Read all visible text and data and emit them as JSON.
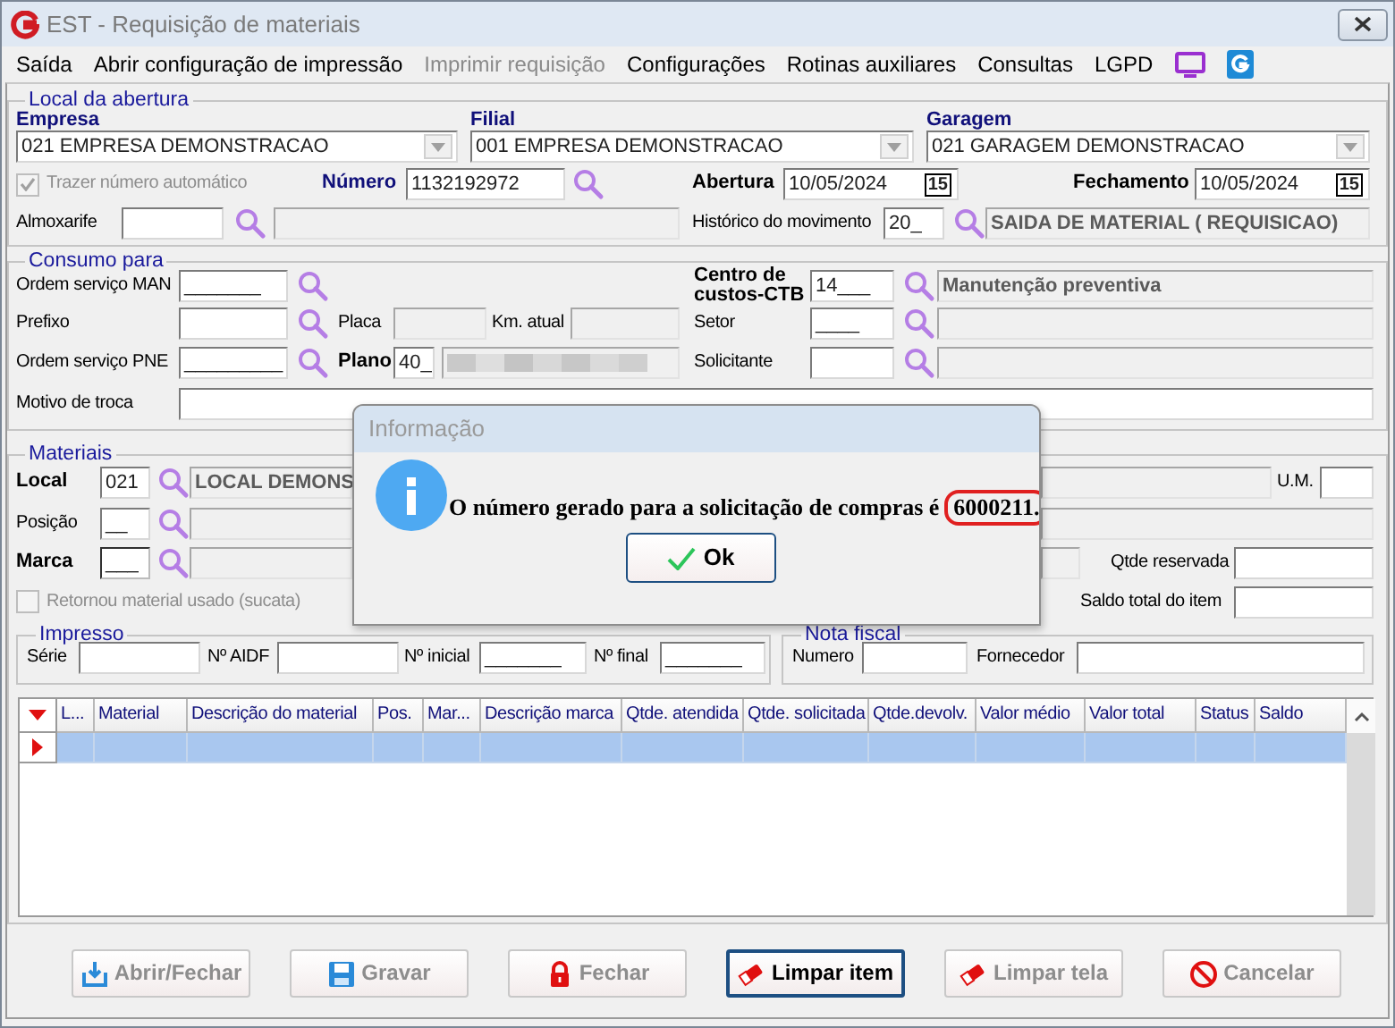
{
  "window": {
    "title": "EST - Requisição de materiais"
  },
  "menu": [
    {
      "label": "Saída",
      "disabled": false
    },
    {
      "label": "Abrir configuração de impressão",
      "disabled": false
    },
    {
      "label": "Imprimir requisição",
      "disabled": true
    },
    {
      "label": "Configurações",
      "disabled": false
    },
    {
      "label": "Rotinas auxiliares",
      "disabled": false
    },
    {
      "label": "Consultas",
      "disabled": false
    },
    {
      "label": "LGPD",
      "disabled": false
    }
  ],
  "menu_icons": [
    {
      "kind": "monitor"
    },
    {
      "kind": "logo"
    }
  ],
  "local_abertura": {
    "title": "Local da abertura",
    "combos": [
      {
        "label": "Empresa",
        "value": "021 EMPRESA DEMONSTRACAO"
      },
      {
        "label": "Filial",
        "value": "001 EMPRESA DEMONSTRACAO"
      },
      {
        "label": "Garagem",
        "value": "021 GARAGEM DEMONSTRACAO"
      }
    ],
    "auto_number": {
      "label": "Trazer número automático",
      "checked": true,
      "disabled": true
    },
    "numero": {
      "label": "Número",
      "value": "1132192972"
    },
    "abertura": {
      "label": "Abertura",
      "value": "10/05/2024",
      "calendar": "15"
    },
    "fechamento": {
      "label": "Fechamento",
      "value": "10/05/2024",
      "calendar": "15"
    },
    "almoxarife": {
      "label": "Almoxarife"
    },
    "historico": {
      "label": "Histórico do movimento",
      "value": "20_",
      "description": "SAIDA DE MATERIAL ( REQUISICAO)"
    }
  },
  "consumo": {
    "title": "Consumo para",
    "ordem_man": {
      "label": "Ordem serviço MAN",
      "value": "_______"
    },
    "centro_custos": {
      "label": "Centro de custos-CTB",
      "value": "14___",
      "description": "Manutenção preventiva"
    },
    "prefixo": {
      "label": "Prefixo"
    },
    "placa": {
      "label": "Placa"
    },
    "km_atual": {
      "label": "Km. atual"
    },
    "setor": {
      "label": "Setor",
      "value": "____"
    },
    "ordem_pne": {
      "label": "Ordem serviço PNE",
      "value": "_________"
    },
    "plano": {
      "label": "Plano",
      "value": "40_",
      "blurred": true
    },
    "solicitante": {
      "label": "Solicitante"
    },
    "motivo": {
      "label": "Motivo de troca"
    }
  },
  "materiais": {
    "title": "Materiais",
    "local": {
      "label": "Local",
      "value": "021",
      "description": "LOCAL DEMONS"
    },
    "um": {
      "label": "U.M."
    },
    "posicao": {
      "label": "Posição",
      "value": "__"
    },
    "marca": {
      "label": "Marca",
      "value": "___"
    },
    "qtde_reservada": {
      "label": "Qtde reservada"
    },
    "retornou": {
      "label": "Retornou material usado (sucata)",
      "checked": false,
      "disabled": true
    },
    "saldo_total": {
      "label": "Saldo total do item"
    },
    "impresso": {
      "title": "Impresso",
      "fields": [
        {
          "label": "Série"
        },
        {
          "label": "Nº AIDF"
        },
        {
          "label": "Nº inicial",
          "value": "_______"
        },
        {
          "label": "Nº final",
          "value": "_______"
        }
      ]
    },
    "nota_fiscal": {
      "title": "Nota fiscal",
      "fields": [
        {
          "label": "Numero"
        },
        {
          "label": "Fornecedor"
        }
      ]
    },
    "grid": {
      "columns": [
        "L...",
        "Material",
        "Descrição do material",
        "Pos.",
        "Mar...",
        "Descrição marca",
        "Qtde. atendida",
        "Qtde. solicitada",
        "Qtde.devolv.",
        "Valor médio",
        "Valor total",
        "Status",
        "Saldo"
      ],
      "rows": [
        {
          "selected": true
        }
      ]
    }
  },
  "buttons": [
    {
      "label": "Abrir/Fechar",
      "kind": "open",
      "disabled": true
    },
    {
      "label": "Gravar",
      "kind": "save",
      "disabled": true
    },
    {
      "label": "Fechar",
      "kind": "lock",
      "disabled": true
    },
    {
      "label": "Limpar item",
      "kind": "clear_item",
      "disabled": false
    },
    {
      "label": "Limpar tela",
      "kind": "clear_screen",
      "disabled": true
    },
    {
      "label": "Cancelar",
      "kind": "cancel",
      "disabled": true
    }
  ],
  "dialog": {
    "title": "Informação",
    "message": "O número gerado para a solicitação de compras é",
    "highlight": "6000211.",
    "button": "Ok"
  }
}
